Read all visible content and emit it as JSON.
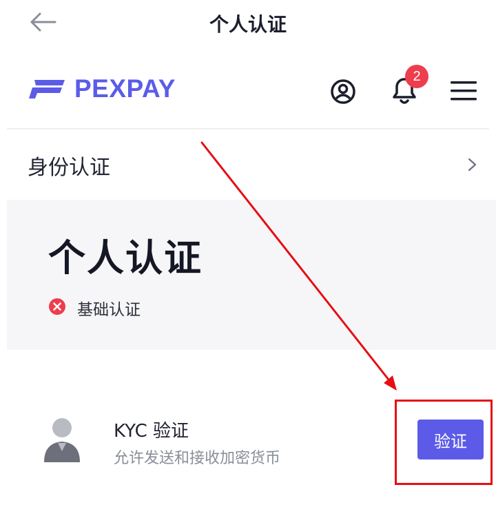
{
  "topbar": {
    "title": "个人认证"
  },
  "header": {
    "brand": "PEXPAY",
    "notification_count": "2"
  },
  "identity_row": {
    "label": "身份认证"
  },
  "panel": {
    "title": "个人认证",
    "status_label": "基础认证",
    "status": "unverified"
  },
  "kyc": {
    "title": "KYC 验证",
    "subtitle": "允许发送和接收加密货币",
    "button_label": "验证"
  },
  "colors": {
    "brand": "#5a5ce8",
    "button": "#5c5be8",
    "badge": "#ee3d4d",
    "annotation": "#e60e12"
  }
}
